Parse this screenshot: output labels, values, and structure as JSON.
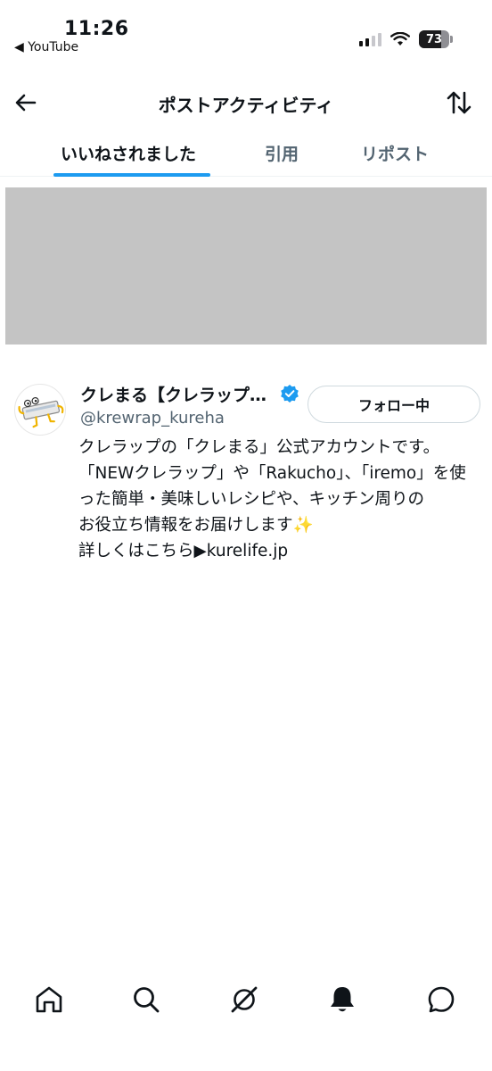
{
  "status_bar": {
    "time": "11:26",
    "back_app": "◀ YouTube",
    "battery": "73",
    "battery_level_pct": 73
  },
  "header": {
    "title": "ポストアクティビティ",
    "back_icon": "arrow-left-icon",
    "sort_icon": "sort-arrows-icon"
  },
  "tabs": [
    {
      "label": "いいねされました",
      "active": true
    },
    {
      "label": "引用",
      "active": false
    },
    {
      "label": "リポスト",
      "active": false
    }
  ],
  "user": {
    "name": "クレまる【クレラップ…",
    "handle": "@krewrap_kureha",
    "verified": true,
    "follow_label": "フォロー中",
    "bio_lines": [
      "クレラップの「クレまる」公式アカウントです。",
      "「NEWクレラップ」や「Rakucho」、「iremo」を使",
      "った簡単・美味しいレシピや、キッチン周りの",
      "お役立ち情報をお届けします",
      "詳しくはこちら▶kurelife.jp"
    ],
    "bio_emoji": "✨"
  },
  "bottom_nav": {
    "items": [
      "home-icon",
      "search-icon",
      "grok-icon",
      "notifications-icon",
      "messages-icon"
    ]
  },
  "colors": {
    "accent": "#1d9bf0",
    "text": "#0f1419",
    "secondary_text": "#536471",
    "placeholder": "#c4c4c4"
  }
}
